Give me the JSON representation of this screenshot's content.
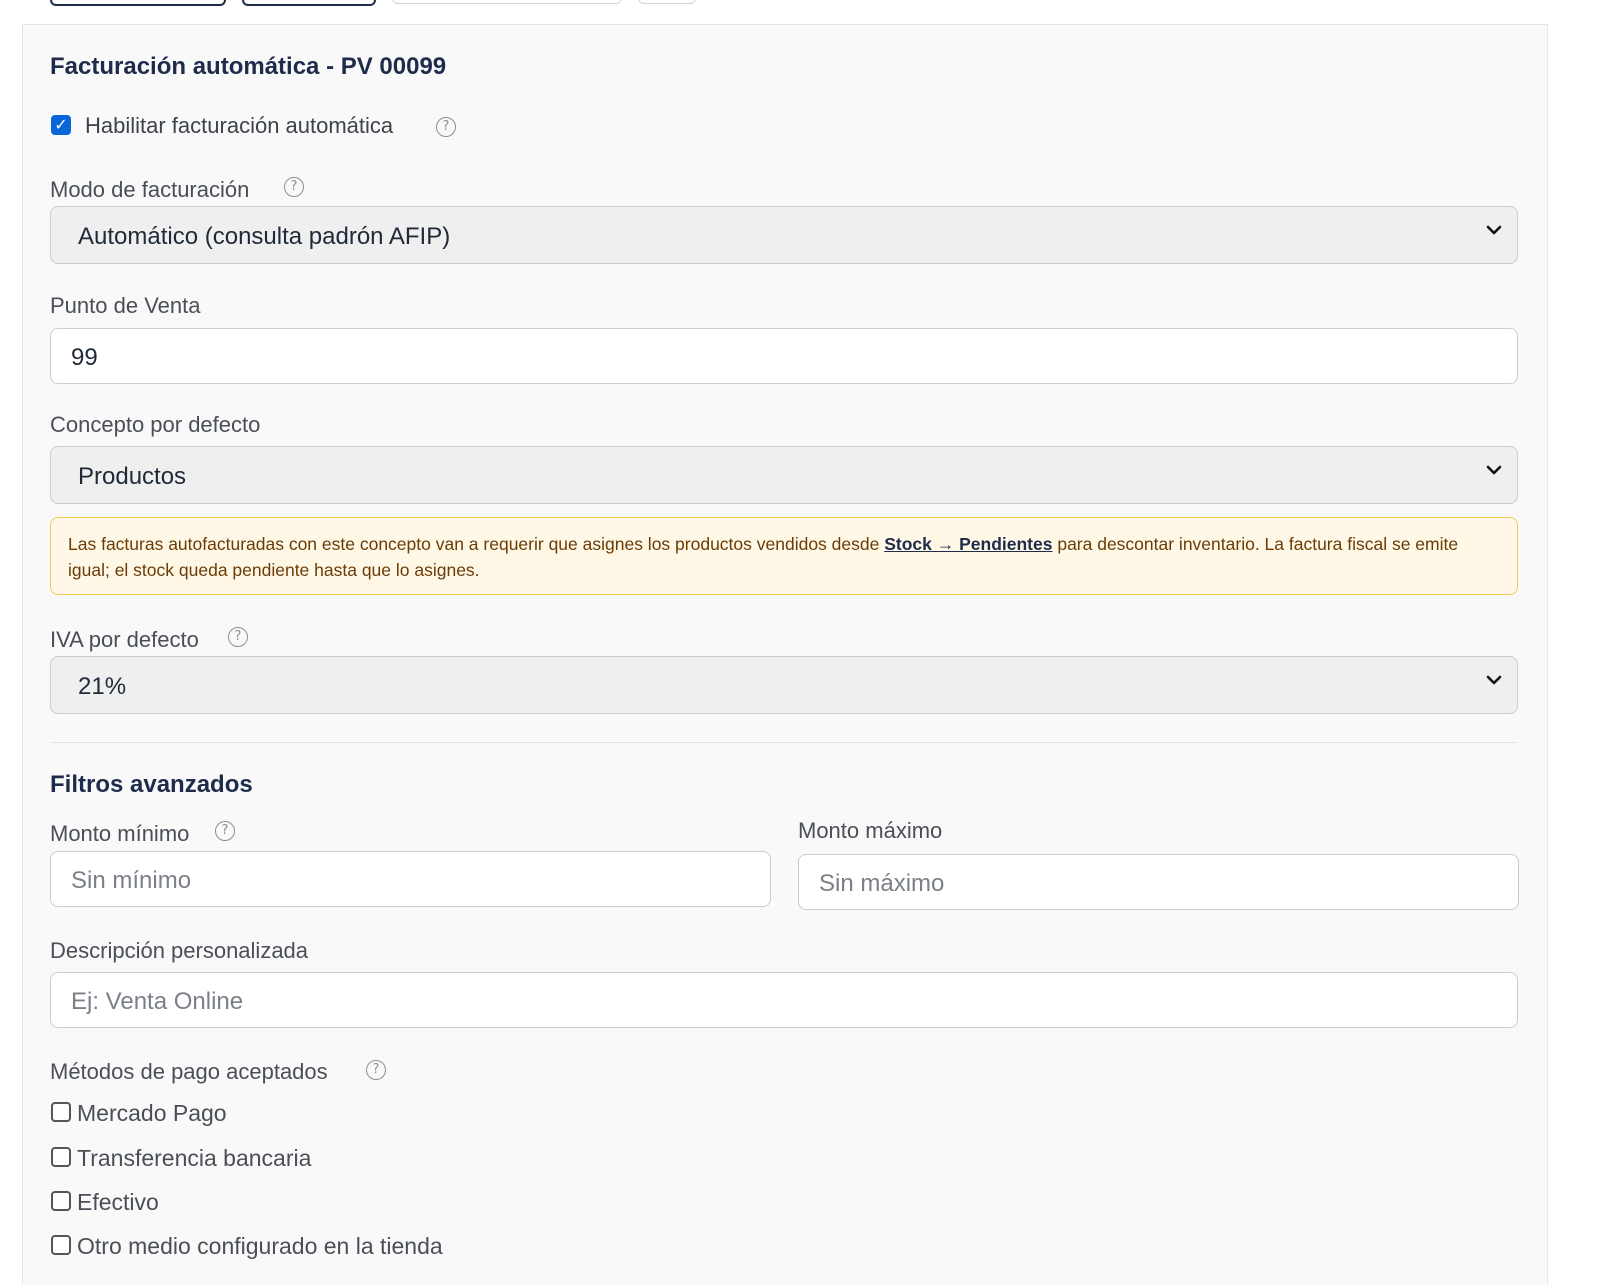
{
  "section_title": "Facturación automática - PV 00099",
  "enable": {
    "label": "Habilitar facturación automática",
    "checked": true
  },
  "billing_mode": {
    "label": "Modo de facturación",
    "value": "Automático (consulta padrón AFIP)"
  },
  "point_of_sale": {
    "label": "Punto de Venta",
    "value": "99"
  },
  "default_concept": {
    "label": "Concepto por defecto",
    "value": "Productos"
  },
  "concept_alert": {
    "text_before": "Las facturas autofacturadas con este concepto van a requerir que asignes los productos vendidos desde ",
    "link": "Stock → Pendientes",
    "text_after": " para descontar inventario. La factura fiscal se emite igual; el stock queda pendiente hasta que lo asignes."
  },
  "default_vat": {
    "label": "IVA por defecto",
    "value": "21%"
  },
  "advanced_filters": {
    "title": "Filtros avanzados",
    "min_amount": {
      "label": "Monto mínimo",
      "placeholder": "Sin mínimo"
    },
    "max_amount": {
      "label": "Monto máximo",
      "placeholder": "Sin máximo"
    }
  },
  "custom_description": {
    "label": "Descripción personalizada",
    "placeholder": "Ej: Venta Online"
  },
  "payment_methods": {
    "label": "Métodos de pago aceptados",
    "items": [
      "Mercado Pago",
      "Transferencia bancaria",
      "Efectivo",
      "Otro medio configurado en la tienda"
    ]
  },
  "colors": {
    "accent": "#0a66d8",
    "heading": "#1e2b4a",
    "alert_bg": "#fff8e7",
    "alert_border": "#f2c85b"
  }
}
